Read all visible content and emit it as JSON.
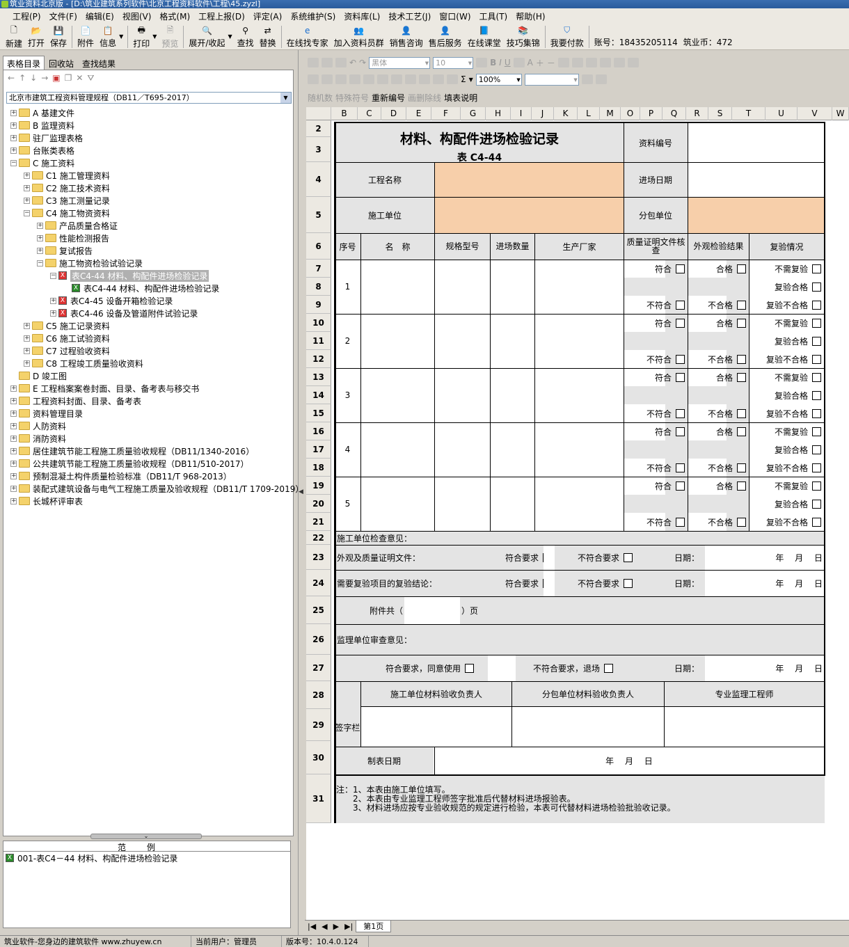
{
  "titlebar": {
    "title": "筑业资料北京版 - [D:\\筑业建筑系列软件\\北京工程资料软件\\工程\\45.zyzl]"
  },
  "menu": [
    "工程(P)",
    "文件(F)",
    "编辑(E)",
    "视图(V)",
    "格式(M)",
    "工程上报(D)",
    "评定(A)",
    "系统维护(S)",
    "资料库(L)",
    "技术工艺(J)",
    "窗口(W)",
    "工具(T)",
    "帮助(H)"
  ],
  "toolbar": {
    "new": "新建",
    "open": "打开",
    "save": "保存",
    "attach": "附件",
    "info": "信息",
    "print": "打印",
    "preview": "预览",
    "expand": "展开/收起",
    "find": "查找",
    "replace": "替换",
    "online_expert": "在线找专家",
    "join_group": "加入资料员群",
    "sales": "销售咨询",
    "aftersales": "售后服务",
    "classroom": "在线课堂",
    "tips": "技巧集锦",
    "pay": "我要付款",
    "account": "账号：18435205114",
    "coins": "筑业币：472"
  },
  "left": {
    "tabs": [
      "表格目录",
      "回收站",
      "查找结果"
    ],
    "combo": "北京市建筑工程资料管理规程（DB11／T695-2017）",
    "tree": [
      {
        "label": "A 基建文件",
        "level": 0,
        "exp": "+",
        "icon": "folder"
      },
      {
        "label": "B 监理资料",
        "level": 0,
        "exp": "+",
        "icon": "folder"
      },
      {
        "label": "驻厂监理表格",
        "level": 0,
        "exp": "+",
        "icon": "folder"
      },
      {
        "label": "台账类表格",
        "level": 0,
        "exp": "+",
        "icon": "folder"
      },
      {
        "label": "C 施工资料",
        "level": 0,
        "exp": "-",
        "icon": "folder"
      },
      {
        "label": "C1 施工管理资料",
        "level": 1,
        "exp": "+",
        "icon": "folder"
      },
      {
        "label": "C2 施工技术资料",
        "level": 1,
        "exp": "+",
        "icon": "folder"
      },
      {
        "label": "C3 施工测量记录",
        "level": 1,
        "exp": "+",
        "icon": "folder"
      },
      {
        "label": "C4 施工物资资料",
        "level": 1,
        "exp": "-",
        "icon": "folder"
      },
      {
        "label": "产品质量合格证",
        "level": 2,
        "exp": "+",
        "icon": "folder"
      },
      {
        "label": "性能检测报告",
        "level": 2,
        "exp": "+",
        "icon": "folder"
      },
      {
        "label": "复试报告",
        "level": 2,
        "exp": "+",
        "icon": "folder"
      },
      {
        "label": "施工物资检验试验记录",
        "level": 2,
        "exp": "-",
        "icon": "folder"
      },
      {
        "label": "表C4-44 材料、构配件进场检验记录",
        "level": 3,
        "exp": "-",
        "icon": "red",
        "sel": true
      },
      {
        "label": "表C4-44 材料、构配件进场检验记录",
        "level": 4,
        "exp": "",
        "icon": "green"
      },
      {
        "label": "表C4-45 设备开箱检验记录",
        "level": 3,
        "exp": "+",
        "icon": "red"
      },
      {
        "label": "表C4-46 设备及管道附件试验记录",
        "level": 3,
        "exp": "+",
        "icon": "red"
      },
      {
        "label": "C5 施工记录资料",
        "level": 1,
        "exp": "+",
        "icon": "folder"
      },
      {
        "label": "C6 施工试验资料",
        "level": 1,
        "exp": "+",
        "icon": "folder"
      },
      {
        "label": "C7 过程验收资料",
        "level": 1,
        "exp": "+",
        "icon": "folder"
      },
      {
        "label": "C8 工程竣工质量验收资料",
        "level": 1,
        "exp": "+",
        "icon": "folder"
      },
      {
        "label": "D 竣工图",
        "level": 0,
        "exp": "",
        "icon": "folder"
      },
      {
        "label": "E 工程档案案卷封面、目录、备考表与移交书",
        "level": 0,
        "exp": "+",
        "icon": "folder"
      },
      {
        "label": "工程资料封面、目录、备考表",
        "level": 0,
        "exp": "+",
        "icon": "folder"
      },
      {
        "label": "资料管理目录",
        "level": 0,
        "exp": "+",
        "icon": "folder"
      },
      {
        "label": "人防资料",
        "level": 0,
        "exp": "+",
        "icon": "folder"
      },
      {
        "label": "消防资料",
        "level": 0,
        "exp": "+",
        "icon": "folder"
      },
      {
        "label": "居住建筑节能工程施工质量验收规程（DB11/1340-2016）",
        "level": 0,
        "exp": "+",
        "icon": "folder"
      },
      {
        "label": "公共建筑节能工程施工质量验收规程（DB11/510-2017）",
        "level": 0,
        "exp": "+",
        "icon": "folder"
      },
      {
        "label": "预制混凝土构件质量检验标准（DB11/T 968-2013）",
        "level": 0,
        "exp": "+",
        "icon": "folder"
      },
      {
        "label": "装配式建筑设备与电气工程施工质量及验收规程（DB11/T 1709-2019）",
        "level": 0,
        "exp": "+",
        "icon": "folder"
      },
      {
        "label": "长城杯评审表",
        "level": 0,
        "exp": "+",
        "icon": "folder"
      }
    ],
    "sample_head": "范例",
    "sample_item": "001-表C4－44 材料、构配件进场检验记录"
  },
  "format": {
    "font": "黑体",
    "size": "10",
    "zoom": "100%",
    "random": "随机数",
    "special": "特殊符号",
    "renumber": "重新编号",
    "delline": "画删除线",
    "fillhelp": "填表说明"
  },
  "sheet": {
    "cols": [
      "B",
      "C",
      "D",
      "E",
      "F",
      "G",
      "H",
      "I",
      "J",
      "K",
      "L",
      "M",
      "O",
      "P",
      "Q",
      "R",
      "S",
      "T",
      "U",
      "V",
      "W"
    ],
    "rows": [
      "2",
      "3",
      "4",
      "5",
      "6",
      "7",
      "8",
      "9",
      "10",
      "11",
      "12",
      "13",
      "14",
      "15",
      "16",
      "17",
      "18",
      "19",
      "20",
      "21",
      "22",
      "23",
      "24",
      "25",
      "26",
      "27",
      "28",
      "29",
      "30",
      "31"
    ],
    "title": "材料、构配件进场检验记录",
    "subtitle": "表 C4-44",
    "doc_no": "资料编号",
    "proj_name": "工程名称",
    "entry_date": "进场日期",
    "contractor": "施工单位",
    "subcontractor": "分包单位",
    "h_no": "序号",
    "h_name": "名　称",
    "h_spec": "规格型号",
    "h_qty": "进场数量",
    "h_maker": "生产厂家",
    "h_cert": "质量证明文件核查",
    "h_appear": "外观检验结果",
    "h_retest": "复验情况",
    "items": [
      "1",
      "2",
      "3",
      "4",
      "5"
    ],
    "ok": "符合",
    "notok": "不符合",
    "pass": "合格",
    "fail": "不合格",
    "noretest": "不需复验",
    "retest_pass": "复验合格",
    "retest_fail": "复验不合格",
    "r22": "施工单位检查意见：",
    "r23": "外观及质量证明文件：",
    "r24": "需要复验项目的复验结论：",
    "meet": "符合要求",
    "notmeet": "不符合要求",
    "date": "日期：",
    "ymd": "年　 月　 日",
    "attach_l": "附件共（",
    "attach_r": "）页",
    "r26": "监理单位审查意见：",
    "r27a": "符合要求，同意使用",
    "r27b": "不符合要求，退场",
    "sign": "签字栏",
    "s1": "施工单位材料验收负责人",
    "s2": "分包单位材料验收负责人",
    "s3": "专业监理工程师",
    "made_date": "制表日期",
    "notes": [
      "注：1、本表由施工单位填写。",
      "　　2、本表由专业监理工程师签字批准后代替材料进场报验表。",
      "　　3、材料进场应按专业验收规范的规定进行检验，本表可代替材料进场检验批验收记录。"
    ]
  },
  "sheettab": "第1页",
  "status": {
    "slogan": "筑业软件-您身边的建筑软件 www.zhuyew.cn",
    "user": "当前用户：管理员",
    "version": "版本号：10.4.0.124"
  },
  "colors": {
    "fill_orange": "#f7cfaa",
    "gray_cell": "#e4e4e4"
  }
}
